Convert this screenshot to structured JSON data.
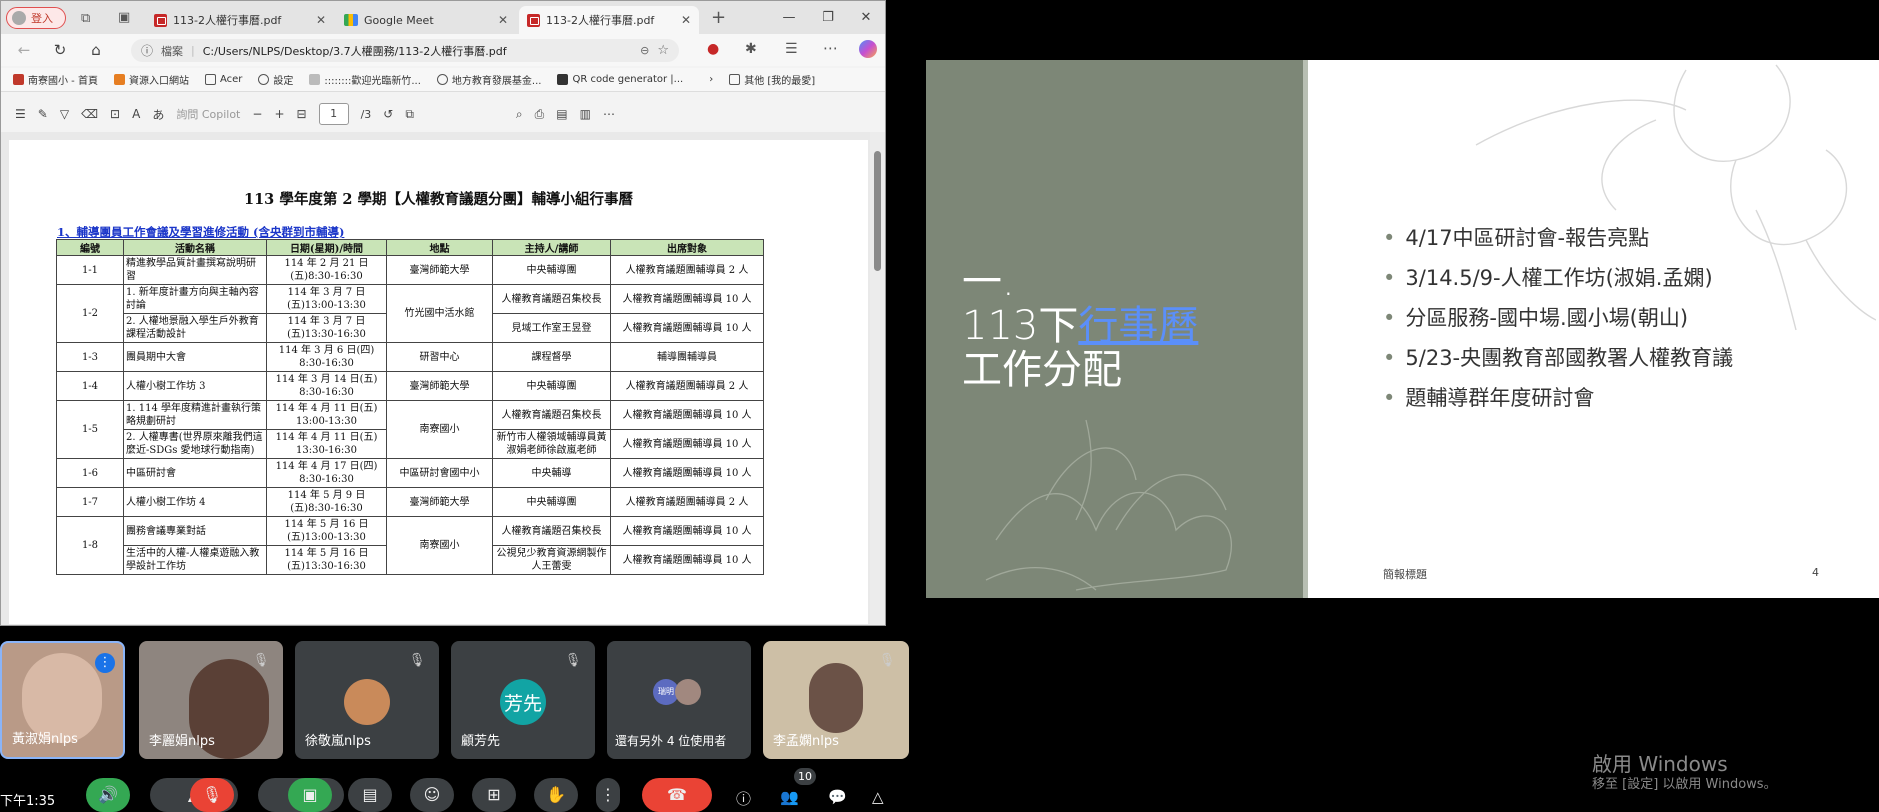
{
  "browser": {
    "login_label": "登入",
    "tabs": [
      {
        "title": "113-2人權行事曆.pdf",
        "icon": "pdf-icon"
      },
      {
        "title": "Google Meet",
        "icon": "meet-icon"
      },
      {
        "title": "113-2人權行事曆.pdf",
        "icon": "pdf-icon"
      }
    ],
    "address": {
      "site_label": "檔案",
      "url": "C:/Users/NLPS/Desktop/3.7人權團務/113-2人權行事曆.pdf"
    },
    "bookmarks": [
      "南寮國小 - 首頁",
      "資源入口網站",
      "Acer",
      "設定",
      "::::::::歡迎光臨新竹...",
      "地方教育發展基金...",
      "QR code generator |...",
      "其他 [我的最愛]"
    ],
    "pdf_toolbar": {
      "copilot_label": "詢問 Copilot",
      "page": "1",
      "page_total": "/3"
    }
  },
  "document": {
    "title": "113 學年度第 2 學期【人權教育議題分團】輔導小組行事曆",
    "section": "1、輔導團員工作會議及學習進修活動 (含央群到市輔導)",
    "headers": [
      "編號",
      "活動名稱",
      "日期(星期)/時間",
      "地點",
      "主持人/講師",
      "出席對象"
    ],
    "rows": [
      {
        "no": "1-1",
        "events": [
          "精進教學品質計畫撰寫說明研習"
        ],
        "dates": [
          "114 年 2 月 21 日 (五)8:30-16:30"
        ],
        "place": "臺灣師範大學",
        "hosts": [
          "中央輔導團"
        ],
        "att": [
          "人權教育議題團輔導員 2 人"
        ]
      },
      {
        "no": "1-2",
        "events": [
          "1. 新年度計畫方向與主軸內容討論",
          "2. 人權地景融入學生戶外教育課程活動設計"
        ],
        "dates": [
          "114 年 3 月 7 日 (五)13:00-13:30",
          "114 年 3 月 7 日 (五)13:30-16:30"
        ],
        "place": "竹光國中活水館",
        "hosts": [
          "人權教育議題召集校長",
          "見域工作室王昱登"
        ],
        "att": [
          "人權教育議題團輔導員 10 人",
          "人權教育議題團輔導員 10 人"
        ]
      },
      {
        "no": "1-3",
        "events": [
          "團員期中大會"
        ],
        "dates": [
          "114 年 3 月 6 日(四) 8:30-16:30"
        ],
        "place": "研習中心",
        "hosts": [
          "課程督學"
        ],
        "att": [
          "輔導團輔導員"
        ]
      },
      {
        "no": "1-4",
        "events": [
          "人權小樹工作坊 3"
        ],
        "dates": [
          "114 年 3 月 14 日(五) 8:30-16:30"
        ],
        "place": "臺灣師範大學",
        "hosts": [
          "中央輔導團"
        ],
        "att": [
          "人權教育議題團輔導員 2 人"
        ]
      },
      {
        "no": "1-5",
        "events": [
          "1. 114 學年度精進計畫執行策略規劃研討",
          "2. 人權專書(世界原來離我們這麼近-SDGs 愛地球行動指南)"
        ],
        "dates": [
          "114 年 4 月 11 日(五) 13:00-13:30",
          "114 年 4 月 11 日(五) 13:30-16:30"
        ],
        "place": "南寮國小",
        "hosts": [
          "人權教育議題召集校長",
          "新竹市人權領域輔導員黃淑娟老師徐啟嵐老師"
        ],
        "att": [
          "人權教育議題團輔導員 10 人",
          "人權教育議題團輔導員 10 人"
        ]
      },
      {
        "no": "1-6",
        "events": [
          "中區研討會"
        ],
        "dates": [
          "114 年 4 月 17 日(四) 8:30-16:30"
        ],
        "place": "中區研討會國中小",
        "hosts": [
          "中央輔導"
        ],
        "att": [
          "人權教育議題團輔導員 10 人"
        ]
      },
      {
        "no": "1-7",
        "events": [
          "人權小樹工作坊 4"
        ],
        "dates": [
          "114 年 5 月 9 日 (五)8:30-16:30"
        ],
        "place": "臺灣師範大學",
        "hosts": [
          "中央輔導團"
        ],
        "att": [
          "人權教育議題團輔導員 2 人"
        ]
      },
      {
        "no": "1-8",
        "events": [
          "團務會議專業對話",
          "生活中的人權-人權桌遊融入教學設計工作坊"
        ],
        "dates": [
          "114 年 5 月 16 日 (五)13:00-13:30",
          "114 年 5 月 16 日 (五)13:30-16:30"
        ],
        "place": "南寮國小",
        "hosts": [
          "人權教育議題召集校長",
          "公視兒少教育資源網製作人王蕾雯"
        ],
        "att": [
          "人權教育議題團輔導員 10 人",
          "人權教育議題團輔導員 10 人"
        ]
      }
    ]
  },
  "slide": {
    "title_num": "一.",
    "title_line1": "113下",
    "title_link": "行事曆",
    "title_line2": "工作分配",
    "bullets": [
      "4/17中區研討會-報告亮點",
      "3/14.5/9-人權工作坊(淑娟.孟嫻)",
      "分區服務-國中場.國小場(朝山)",
      "5/23-央團教育部國教署人權教育議",
      "題輔導群年度研討會"
    ],
    "footer_left": "簡報標題",
    "footer_right": "4"
  },
  "participants": [
    {
      "name": "黃淑娟nlps",
      "speaking": true
    },
    {
      "name": "李麗娟nlps"
    },
    {
      "name": "徐敬嵐nlps",
      "avatar_color": "#c98a5a"
    },
    {
      "name": "顧芳先",
      "initials": "芳先",
      "avatar_color": "#12a4a4"
    },
    {
      "name": "還有另外 4 位使用者",
      "initials": "瑞明"
    },
    {
      "name": "李孟嫻nlps"
    }
  ],
  "meeting": {
    "time": "下午1:35",
    "participant_count": "10"
  },
  "windows": {
    "line1": "啟用 Windows",
    "line2": "移至 [設定] 以啟用 Windows。"
  }
}
